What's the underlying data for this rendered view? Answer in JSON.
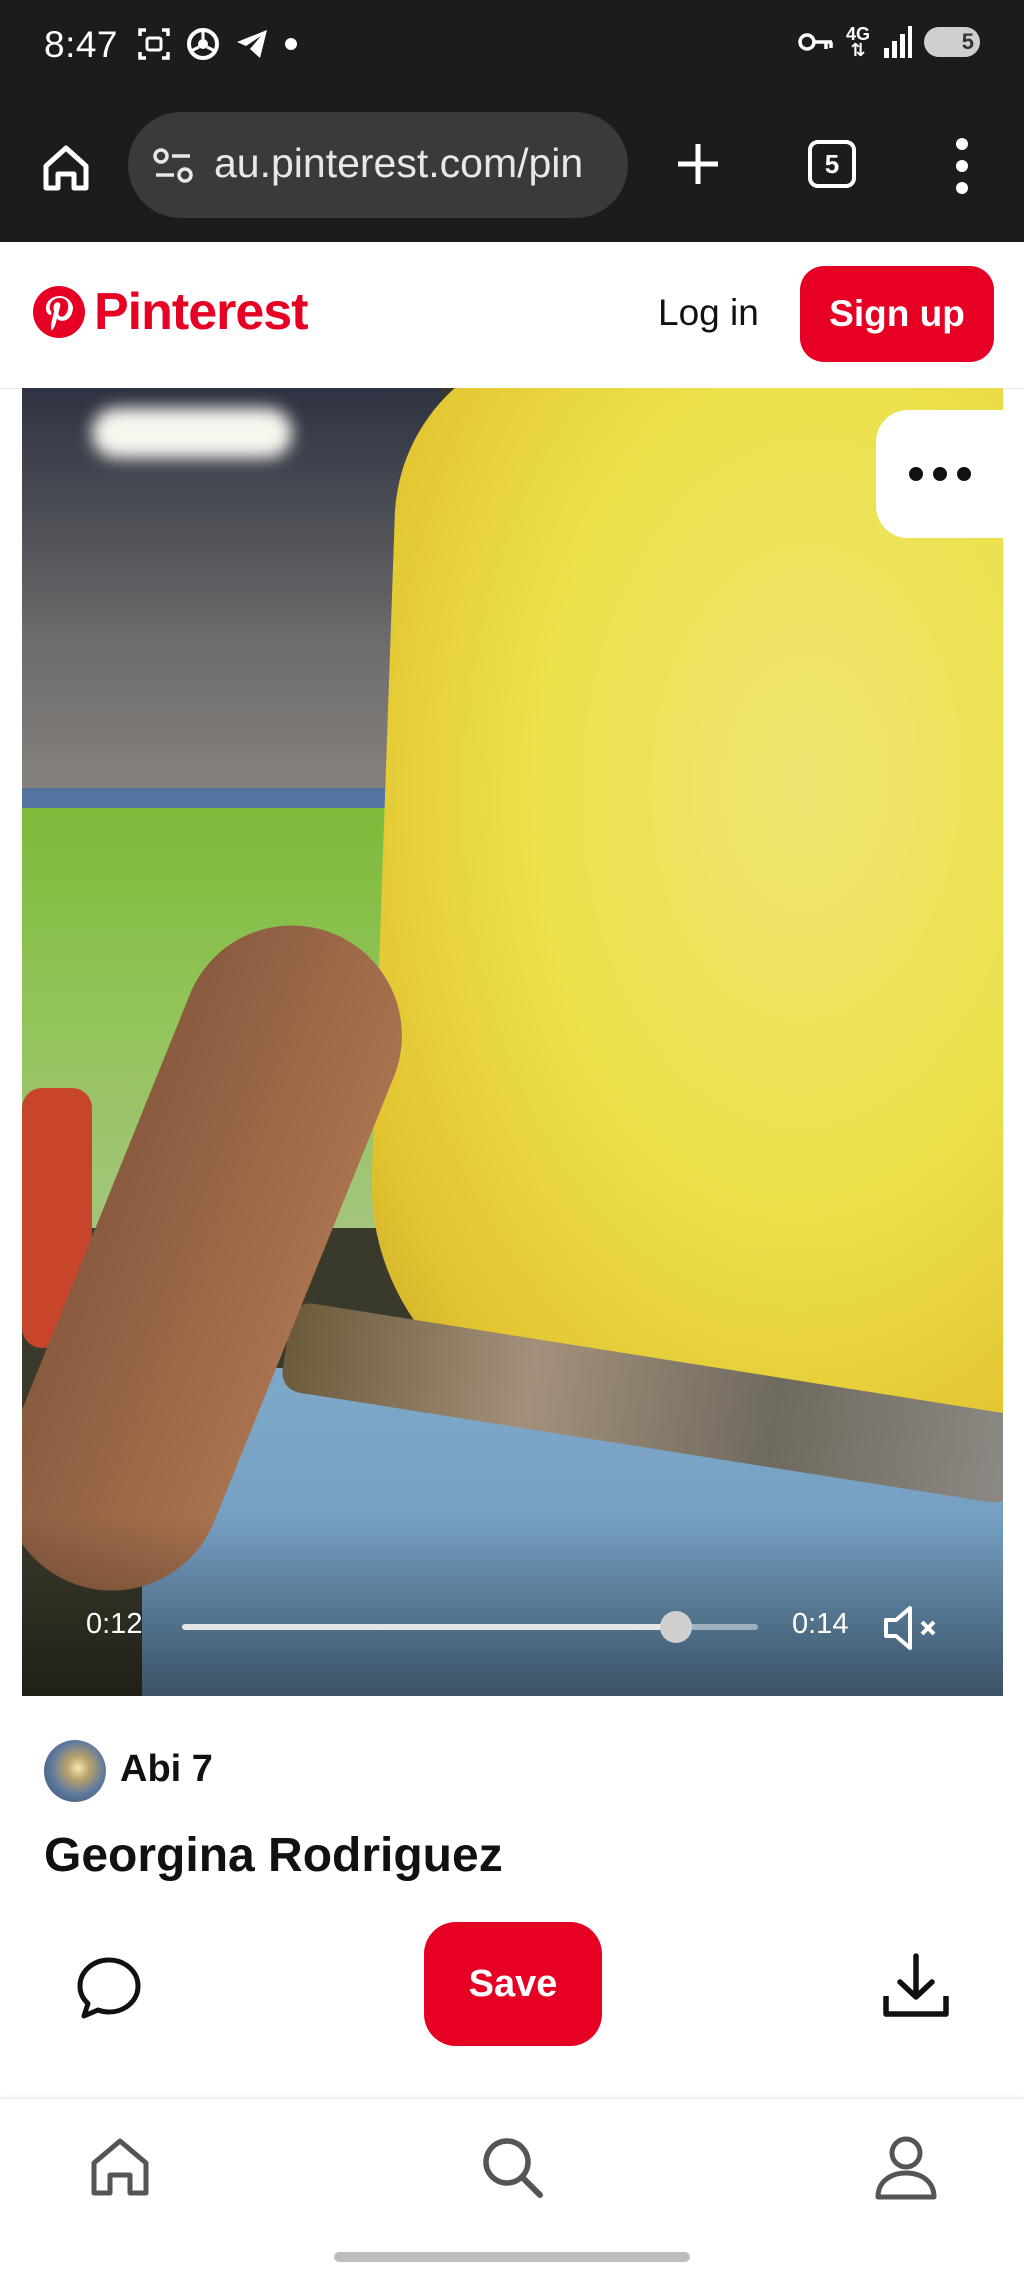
{
  "status_bar": {
    "time": "8:47",
    "network": "4G",
    "battery": "5",
    "left_icons": [
      "screenshot-icon",
      "chrome-icon",
      "telegram-icon",
      "dot-icon"
    ],
    "right_icons": [
      "vpn-key-icon",
      "network-icon",
      "signal-icon",
      "battery-icon"
    ]
  },
  "browser": {
    "url": "au.pinterest.com/pin",
    "tab_count": "5"
  },
  "header": {
    "logo_text": "Pinterest",
    "login_label": "Log in",
    "signup_label": "Sign up",
    "brand_color": "#e60023"
  },
  "video": {
    "current_time": "0:12",
    "duration": "0:14",
    "progress": 0.857,
    "muted": true
  },
  "pin": {
    "author": "Abi 7",
    "title": "Georgina Rodriguez",
    "save_label": "Save"
  },
  "bottom_nav": {
    "items": [
      "home-icon",
      "search-icon",
      "profile-icon"
    ]
  }
}
